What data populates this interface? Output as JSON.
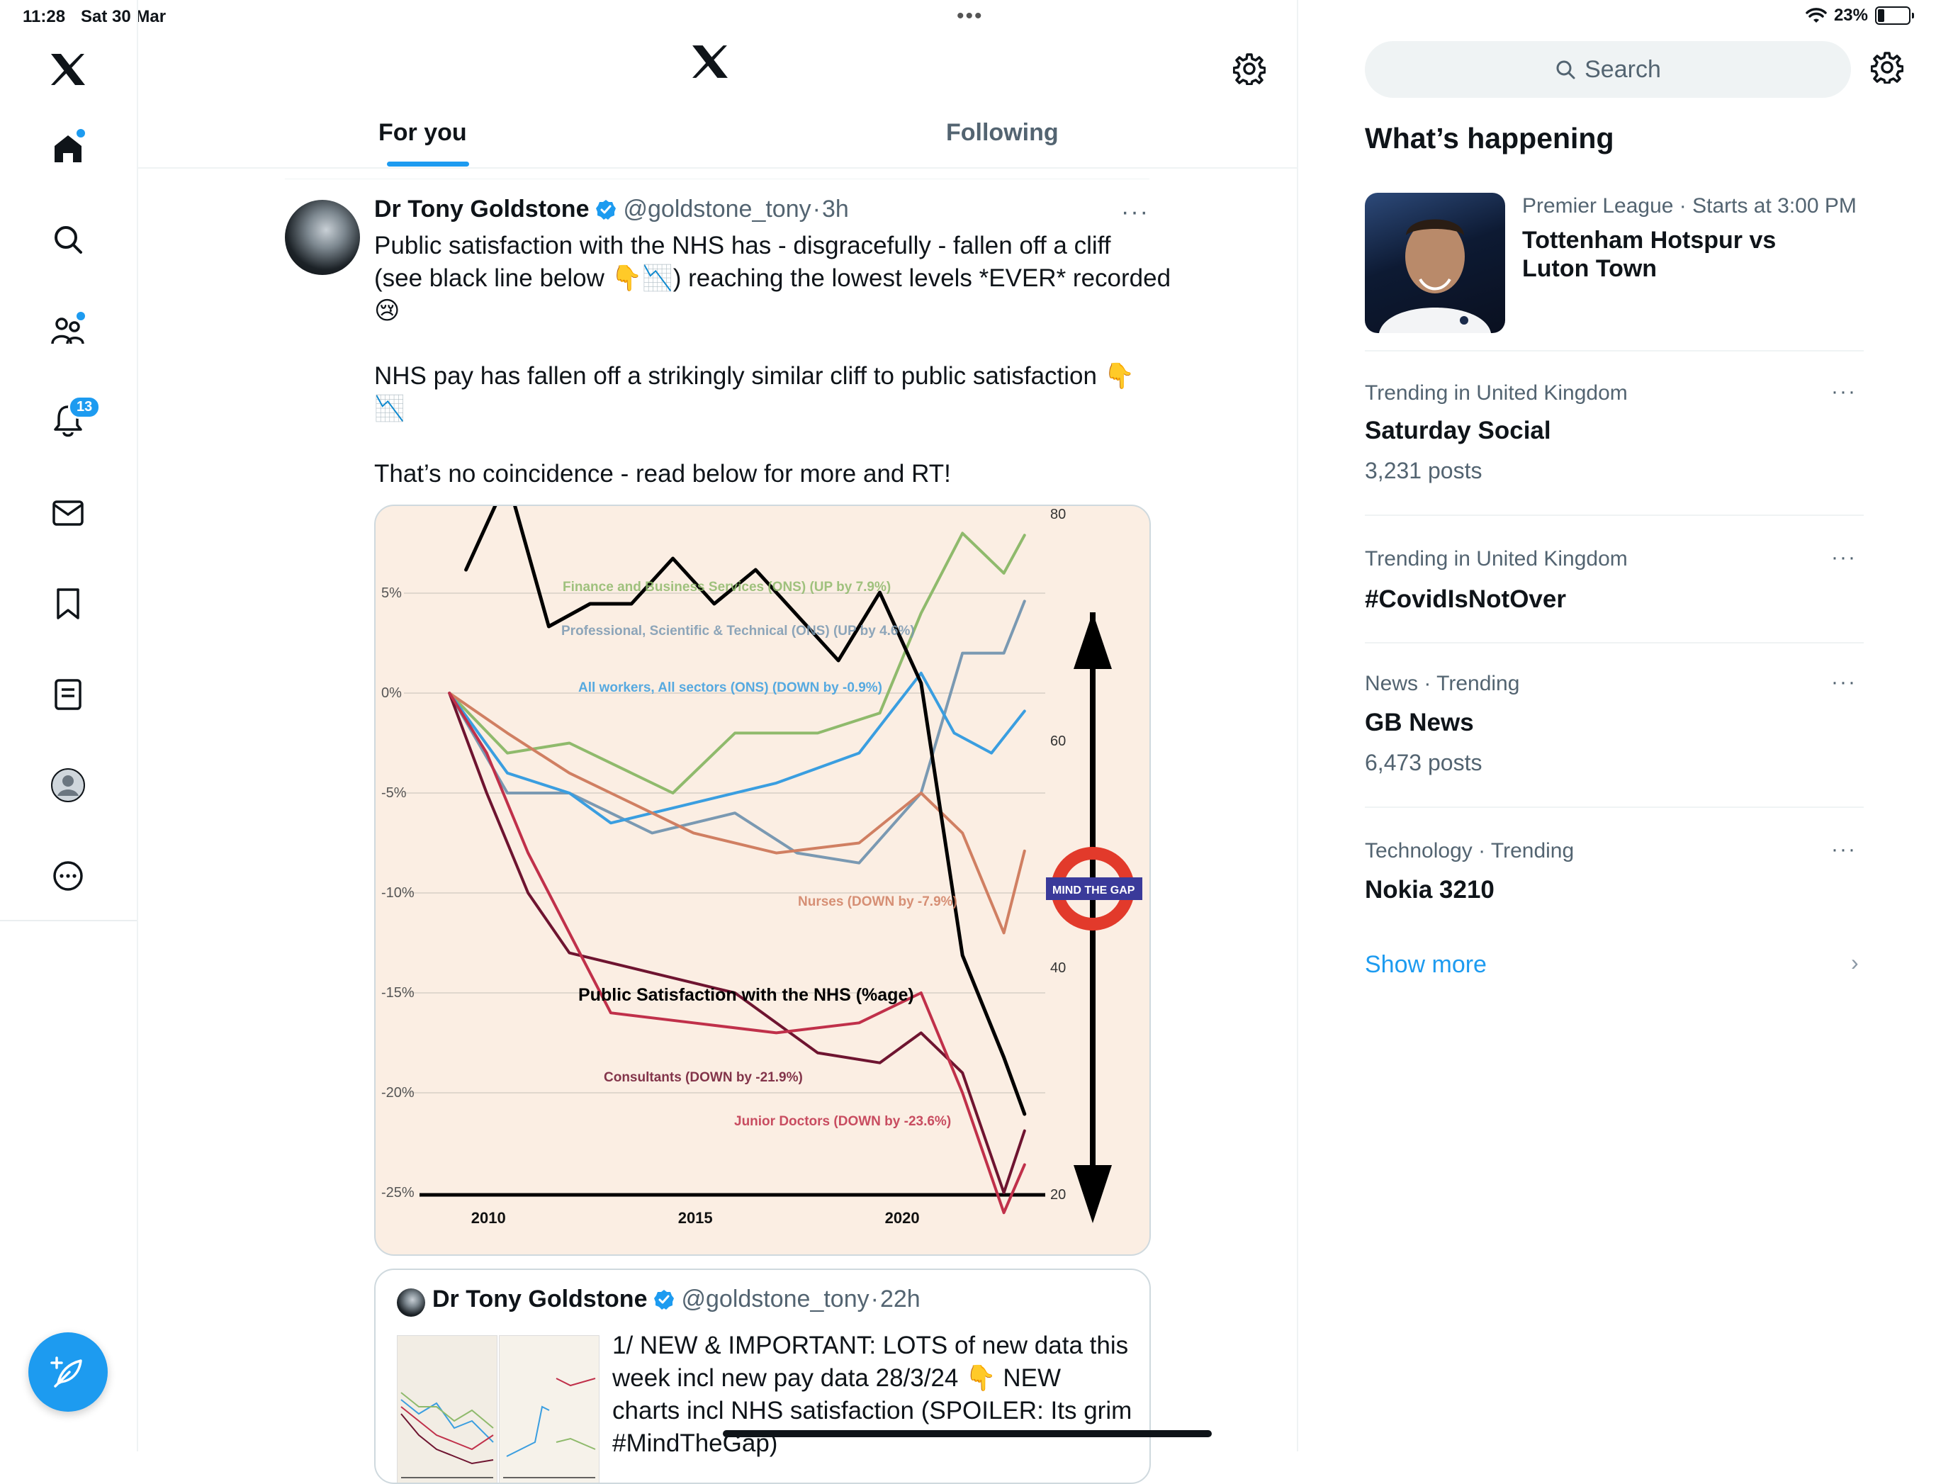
{
  "status_bar": {
    "time": "11:28",
    "date": "Sat 30 Mar",
    "battery": "23%"
  },
  "nav": {
    "items": [
      "home",
      "explore",
      "communities",
      "notifications",
      "messages",
      "bookmarks",
      "lists",
      "profile",
      "more"
    ],
    "notification_count": "13"
  },
  "feed": {
    "tabs": [
      {
        "label": "For you",
        "selected": true
      },
      {
        "label": "Following",
        "selected": false
      }
    ]
  },
  "tweet": {
    "author": "Dr Tony Goldstone",
    "handle": "@goldstone_tony",
    "time": "3h",
    "sep": "·",
    "more": "···",
    "lines": [
      "Public satisfaction with the NHS has - disgracefully - fallen off a cliff",
      "(see black line below 👇📉) reaching the lowest levels *EVER* recorded",
      "😢",
      "NHS pay has fallen off a strikingly similar  cliff to public satisfaction  👇",
      "📉",
      "That’s no coincidence - read below for more and RT!"
    ]
  },
  "chart_data": {
    "type": "line",
    "x_ticks": [
      "2010",
      "2015",
      "2020"
    ],
    "left_axis_ticks": [
      "5%",
      "0%",
      "-5%",
      "-10%",
      "-15%",
      "-20%",
      "-25%"
    ],
    "left_ylim": [
      -25,
      5
    ],
    "right_axis_ticks": [
      "80",
      "60",
      "40",
      "20"
    ],
    "right_ylim": [
      20,
      80
    ],
    "series": [
      {
        "name": "Finance and Business Services (ONS) (UP by 7.9%)",
        "color": "#8fba6c",
        "points": [
          [
            2009.1,
            0
          ],
          [
            2010.5,
            -3
          ],
          [
            2012,
            -2.5
          ],
          [
            2014.5,
            -5
          ],
          [
            2016,
            -2
          ],
          [
            2018,
            -2
          ],
          [
            2019.5,
            -1
          ],
          [
            2020.5,
            4
          ],
          [
            2021.5,
            8
          ],
          [
            2022.5,
            6
          ],
          [
            2023,
            7.9
          ]
        ]
      },
      {
        "name": "Professional, Scientific & Technical (ONS) (UP by 4.6%)",
        "color": "#7a99b2",
        "points": [
          [
            2009.1,
            0
          ],
          [
            2010.5,
            -5
          ],
          [
            2012,
            -5
          ],
          [
            2014,
            -7
          ],
          [
            2016,
            -6
          ],
          [
            2017.5,
            -8
          ],
          [
            2019,
            -8.5
          ],
          [
            2020.5,
            -5
          ],
          [
            2021.5,
            2
          ],
          [
            2022.5,
            2
          ],
          [
            2023,
            4.6
          ]
        ]
      },
      {
        "name": "All workers, All sectors (ONS) (DOWN by -0.9%)",
        "color": "#3a9ee0",
        "points": [
          [
            2009.1,
            0
          ],
          [
            2010.5,
            -4
          ],
          [
            2012,
            -5
          ],
          [
            2013,
            -6.5
          ],
          [
            2015,
            -5.5
          ],
          [
            2017,
            -4.5
          ],
          [
            2019,
            -3
          ],
          [
            2020.5,
            1
          ],
          [
            2021.3,
            -2
          ],
          [
            2022.2,
            -3
          ],
          [
            2023,
            -0.9
          ]
        ]
      },
      {
        "name": "Nurses (DOWN by -7.9%)",
        "color": "#d07f62",
        "points": [
          [
            2009.1,
            0
          ],
          [
            2010.5,
            -2
          ],
          [
            2012,
            -4
          ],
          [
            2013,
            -5
          ],
          [
            2015,
            -7
          ],
          [
            2017,
            -8
          ],
          [
            2019,
            -7.5
          ],
          [
            2020.5,
            -5
          ],
          [
            2021.5,
            -7
          ],
          [
            2022.5,
            -12
          ],
          [
            2023,
            -7.9
          ]
        ]
      },
      {
        "name": "Consultants (DOWN by -21.9%)",
        "color": "#6e1430",
        "points": [
          [
            2009.1,
            0
          ],
          [
            2010,
            -5
          ],
          [
            2011,
            -10
          ],
          [
            2012,
            -13
          ],
          [
            2014,
            -14
          ],
          [
            2016,
            -15
          ],
          [
            2018,
            -18
          ],
          [
            2019.5,
            -18.5
          ],
          [
            2020.5,
            -17
          ],
          [
            2021.5,
            -19
          ],
          [
            2022.5,
            -25
          ],
          [
            2023,
            -21.9
          ]
        ]
      },
      {
        "name": "Junior Doctors (DOWN by -23.6%)",
        "color": "#c0304a",
        "points": [
          [
            2009.1,
            0
          ],
          [
            2010,
            -3
          ],
          [
            2011,
            -8
          ],
          [
            2012,
            -12
          ],
          [
            2013,
            -16
          ],
          [
            2015,
            -16.5
          ],
          [
            2017,
            -17
          ],
          [
            2019,
            -16.5
          ],
          [
            2020.5,
            -15
          ],
          [
            2021.5,
            -20
          ],
          [
            2022.5,
            -26
          ],
          [
            2023,
            -23.6
          ]
        ]
      },
      {
        "name": "Public Satisfaction with the NHS (%age)",
        "color": "#000000",
        "axis": "right",
        "points": [
          [
            2009.5,
            75
          ],
          [
            2010.5,
            83
          ],
          [
            2011.5,
            70
          ],
          [
            2012.5,
            72
          ],
          [
            2013.5,
            72
          ],
          [
            2014.5,
            76
          ],
          [
            2015.5,
            72
          ],
          [
            2016.5,
            75
          ],
          [
            2018.5,
            67
          ],
          [
            2019.5,
            73
          ],
          [
            2020.5,
            65
          ],
          [
            2021.5,
            41
          ],
          [
            2022.5,
            32
          ],
          [
            2023,
            27
          ]
        ]
      }
    ],
    "annotation": "MIND THE GAP"
  },
  "quoted_tweet": {
    "author": "Dr Tony Goldstone",
    "handle": "@goldstone_tony",
    "time": "22h",
    "sep": "·",
    "lines": [
      "1/ NEW & IMPORTANT: LOTS of new data this",
      "week incl new pay data  28/3/24 👇 NEW",
      "charts incl NHS satisfaction (SPOILER: Its grim",
      "#MindTheGap)"
    ]
  },
  "sidebar": {
    "search_placeholder": "Search",
    "section_title": "What’s happening",
    "event": {
      "meta": "Premier League · Starts at 3:00 PM",
      "title_line1": "Tottenham Hotspur vs",
      "title_line2": "Luton Town"
    },
    "trends": [
      {
        "context": "Trending in United Kingdom",
        "title": "Saturday Social",
        "count": "3,231 posts"
      },
      {
        "context": "Trending in United Kingdom",
        "title": "#CovidIsNotOver",
        "count": ""
      },
      {
        "context": "News · Trending",
        "title": "GB News",
        "count": "6,473 posts"
      },
      {
        "context": "Technology · Trending",
        "title": "Nokia 3210",
        "count": ""
      }
    ],
    "trend_more": "···",
    "show_more": "Show more",
    "show_more_chevron": "›"
  },
  "colors": {
    "accent": "#1d9bf0",
    "text": "#0f1419",
    "muted": "#536471",
    "divider": "#eff3f4"
  }
}
